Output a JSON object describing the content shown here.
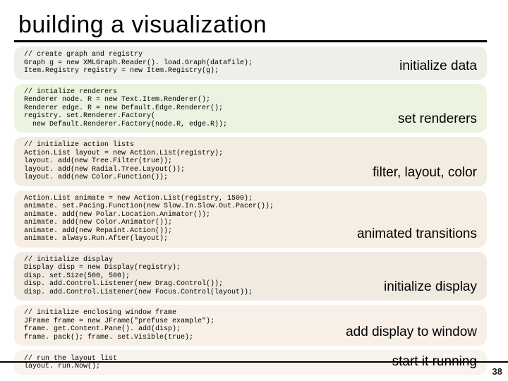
{
  "title": "building a visualization",
  "page_number": "38",
  "blocks": [
    {
      "code": "// create graph and registry\nGraph g = new XMLGraph.Reader(). load.Graph(datafile);\nItem.Registry registry = new Item.Registry(g);",
      "label": "initialize data"
    },
    {
      "code": "// intialize renderers\nRenderer node. R = new Text.Item.Renderer();\nRenderer edge. R = new Default.Edge.Renderer();\nregistry. set.Renderer.Factory(\n  new Default.Renderer.Factory(node.R, edge.R));",
      "label": "set renderers"
    },
    {
      "code": "// initialize action lists\nAction.List layout = new Action.List(registry);\nlayout. add(new Tree.Filter(true));\nlayout. add(new Radial.Tree.Layout());\nlayout. add(new Color.Function());",
      "label": "filter, layout, color"
    },
    {
      "code": "Action.List animate = new Action.List(registry, 1500);\nanimate. set.Pacing.Function(new Slow.In.Slow.Out.Pacer());\nanimate. add(new Polar.Location.Animator());\nanimate. add(new Color.Animator());\nanimate. add(new Repaint.Action());\nanimate. always.Run.After(layout);",
      "label": "animated transitions"
    },
    {
      "code": "// initialize display\nDisplay disp = new Display(registry);\ndisp. set.Size(500, 500);\ndisp. add.Control.Listener(new Drag.Control());\ndisp. add.Control.Listener(new Focus.Control(layout));",
      "label": "initialize display"
    },
    {
      "code": "// initialize enclosing window frame\nJFrame frame = new JFrame(\"prefuse example\");\nframe. get.Content.Pane(). add(disp);\nframe. pack(); frame. set.Visible(true);",
      "label": "add display to window"
    },
    {
      "code": "// run the layout list\nlayout. run.Now();",
      "label": "start it running"
    }
  ]
}
